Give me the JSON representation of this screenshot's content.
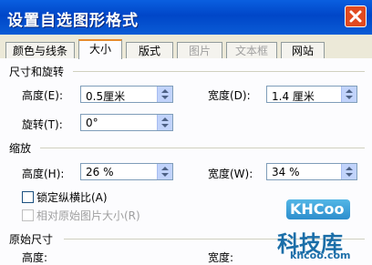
{
  "window": {
    "title": "设置自选图形格式"
  },
  "tabs": [
    {
      "label": "颜色与线条",
      "active": false,
      "disabled": false
    },
    {
      "label": "大小",
      "active": true,
      "disabled": false
    },
    {
      "label": "版式",
      "active": false,
      "disabled": false
    },
    {
      "label": "图片",
      "active": false,
      "disabled": true
    },
    {
      "label": "文本框",
      "active": false,
      "disabled": true
    },
    {
      "label": "网站",
      "active": false,
      "disabled": false
    }
  ],
  "size_rotate": {
    "heading": "尺寸和旋转",
    "height_label": "高度(E):",
    "height_value": "0.5厘米",
    "width_label": "宽度(D):",
    "width_value": "1.4 厘米",
    "rotation_label": "旋转(T):",
    "rotation_value": "0°"
  },
  "scale": {
    "heading": "缩放",
    "height_label": "高度(H):",
    "height_value": "26 %",
    "width_label": "宽度(W):",
    "width_value": "34 %",
    "lock_aspect_label": "锁定纵横比(A)",
    "relative_label": "相对原始图片大小(R)"
  },
  "original": {
    "heading": "原始尺寸",
    "height_label": "高度:",
    "width_label": "宽度:"
  },
  "watermark": {
    "logo": "KHCoo",
    "name": "科技库",
    "url": "khcoo.com"
  }
}
